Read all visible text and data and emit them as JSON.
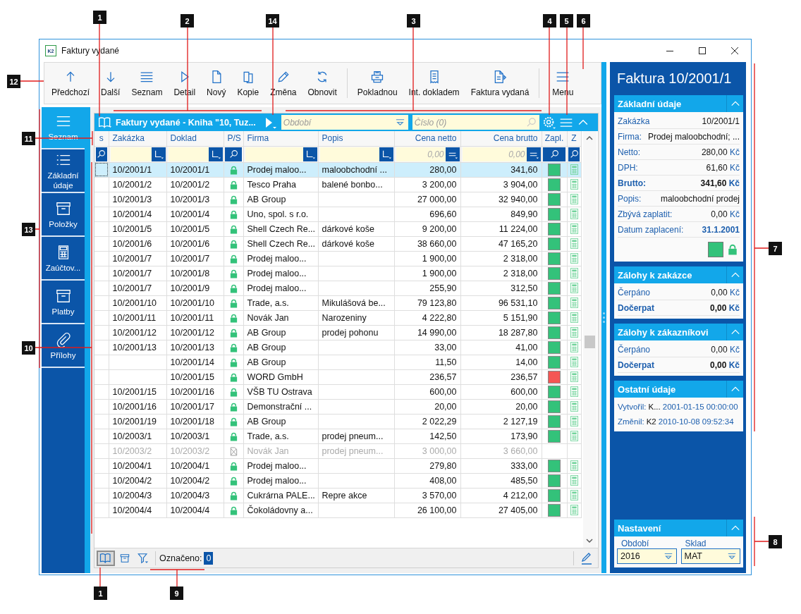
{
  "window": {
    "title": "Faktury vydané",
    "app_icon_label": "K2"
  },
  "toolbar": {
    "groups": [
      [
        {
          "label": "Předchozí",
          "kind": "up"
        },
        {
          "label": "Další",
          "kind": "down"
        },
        {
          "label": "Seznam",
          "kind": "list"
        },
        {
          "label": "Detail",
          "kind": "play"
        },
        {
          "label": "Nový",
          "kind": "page"
        },
        {
          "label": "Kopie",
          "kind": "copy"
        },
        {
          "label": "Změna",
          "kind": "pencil"
        },
        {
          "label": "Obnovit",
          "kind": "refresh"
        }
      ],
      [
        {
          "label": "Pokladnou",
          "kind": "register"
        },
        {
          "label": "Int. dokladem",
          "kind": "receipt"
        },
        {
          "label": "Faktura vydaná",
          "kind": "docarrow"
        }
      ],
      [
        {
          "label": "Menu",
          "kind": "menu"
        }
      ]
    ]
  },
  "nav": [
    {
      "label": "Seznam",
      "kind": "menu",
      "selected": true
    },
    {
      "label": "Základní údaje",
      "kind": "bullets",
      "selected": false
    },
    {
      "label": "Položky",
      "kind": "box",
      "selected": false
    },
    {
      "label": "Zaúčtov...",
      "kind": "calc",
      "selected": false
    },
    {
      "label": "Platby",
      "kind": "box",
      "selected": false
    },
    {
      "label": "Přílohy",
      "kind": "clip",
      "selected": false
    }
  ],
  "grid": {
    "title": "Faktury vydané - Kniha \"10, Tuz...",
    "period_placeholder": "Období",
    "number_placeholder": "Číslo (0)",
    "columns": [
      "s",
      "Zakázka",
      "Doklad",
      "P/S",
      "Firma",
      "Popis",
      "Cena netto",
      "Cena brutto",
      "Zapl.",
      "Z"
    ],
    "filters": [
      {
        "kind": "search"
      },
      {
        "kind": "text"
      },
      {
        "kind": "text"
      },
      {
        "kind": "search"
      },
      {
        "kind": "text"
      },
      {
        "kind": "text"
      },
      {
        "kind": "number",
        "placeholder": "0,00"
      },
      {
        "kind": "number",
        "placeholder": "0,00"
      },
      {
        "kind": "search"
      },
      {
        "kind": "search"
      }
    ],
    "rows": [
      {
        "zakazka": "10/2001/1",
        "doklad": "10/2001/1",
        "cancelled": false,
        "firma": "Prodej maloo...",
        "popis": "maloobchodní ...",
        "netto": "280,00",
        "brutto": "341,60",
        "color": "#33c27a",
        "accounted": true,
        "selected": true,
        "disabled": false
      },
      {
        "zakazka": "10/2001/2",
        "doklad": "10/2001/2",
        "cancelled": false,
        "firma": "Tesco Praha",
        "popis": "balené bonbo...",
        "netto": "3 200,00",
        "brutto": "3 904,00",
        "color": "#33c27a",
        "accounted": true,
        "selected": false,
        "disabled": false
      },
      {
        "zakazka": "10/2001/3",
        "doklad": "10/2001/3",
        "cancelled": false,
        "firma": "AB Group",
        "netto": "27 000,00",
        "brutto": "32 940,00",
        "color": "#33c27a",
        "accounted": true,
        "selected": false,
        "disabled": false
      },
      {
        "zakazka": "10/2001/4",
        "doklad": "10/2001/4",
        "cancelled": false,
        "firma": "Uno, spol. s r.o.",
        "netto": "696,60",
        "brutto": "849,90",
        "color": "#33c27a",
        "accounted": true,
        "selected": false,
        "disabled": false
      },
      {
        "zakazka": "10/2001/5",
        "doklad": "10/2001/5",
        "cancelled": false,
        "firma": "Shell Czech Re...",
        "popis": "dárkové koše",
        "netto": "9 200,00",
        "brutto": "11 224,00",
        "color": "#33c27a",
        "accounted": true,
        "selected": false,
        "disabled": false
      },
      {
        "zakazka": "10/2001/6",
        "doklad": "10/2001/6",
        "cancelled": false,
        "firma": "Shell Czech Re...",
        "popis": "dárkové koše",
        "netto": "38 660,00",
        "brutto": "47 165,20",
        "color": "#33c27a",
        "accounted": true,
        "selected": false,
        "disabled": false
      },
      {
        "zakazka": "10/2001/7",
        "doklad": "10/2001/7",
        "cancelled": false,
        "firma": "Prodej maloo...",
        "netto": "1 900,00",
        "brutto": "2 318,00",
        "color": "#33c27a",
        "accounted": true,
        "selected": false,
        "disabled": false
      },
      {
        "zakazka": "10/2001/7",
        "doklad": "10/2001/8",
        "cancelled": false,
        "firma": "Prodej maloo...",
        "netto": "1 900,00",
        "brutto": "2 318,00",
        "color": "#33c27a",
        "accounted": true,
        "selected": false,
        "disabled": false
      },
      {
        "zakazka": "10/2001/7",
        "doklad": "10/2001/9",
        "cancelled": false,
        "firma": "Prodej maloo...",
        "netto": "255,90",
        "brutto": "312,50",
        "color": "#33c27a",
        "accounted": true,
        "selected": false,
        "disabled": false
      },
      {
        "zakazka": "10/2001/10",
        "doklad": "10/2001/10",
        "cancelled": false,
        "firma": "Trade, a.s.",
        "popis": "Mikulášová be...",
        "netto": "79 123,80",
        "brutto": "96 531,10",
        "color": "#33c27a",
        "accounted": true,
        "selected": false,
        "disabled": false
      },
      {
        "zakazka": "10/2001/11",
        "doklad": "10/2001/11",
        "cancelled": false,
        "firma": "Novák Jan",
        "popis": "Narozeniny",
        "netto": "4 222,80",
        "brutto": "5 151,90",
        "color": "#33c27a",
        "accounted": true,
        "selected": false,
        "disabled": false
      },
      {
        "zakazka": "10/2001/12",
        "doklad": "10/2001/12",
        "cancelled": false,
        "firma": "AB Group",
        "popis": "prodej pohonu",
        "netto": "14 990,00",
        "brutto": "18 287,80",
        "color": "#33c27a",
        "accounted": true,
        "selected": false,
        "disabled": false
      },
      {
        "zakazka": "10/2001/13",
        "doklad": "10/2001/13",
        "cancelled": false,
        "firma": "AB Group",
        "netto": "33,00",
        "brutto": "41,00",
        "color": "#33c27a",
        "accounted": true,
        "selected": false,
        "disabled": false
      },
      {
        "doklad": "10/2001/14",
        "cancelled": false,
        "firma": "AB Group",
        "netto": "11,50",
        "brutto": "14,00",
        "color": "#33c27a",
        "accounted": true,
        "selected": false,
        "disabled": false
      },
      {
        "doklad": "10/2001/15",
        "cancelled": false,
        "firma": "WORD GmbH",
        "netto": "236,57",
        "brutto": "236,57",
        "color": "#f45654",
        "accounted": true,
        "selected": false,
        "disabled": false
      },
      {
        "zakazka": "10/2001/15",
        "doklad": "10/2001/16",
        "cancelled": false,
        "firma": "VŠB TU Ostrava",
        "netto": "600,00",
        "brutto": "600,00",
        "color": "#33c27a",
        "accounted": true,
        "selected": false,
        "disabled": false
      },
      {
        "zakazka": "10/2001/16",
        "doklad": "10/2001/17",
        "cancelled": false,
        "firma": "Demonstrační ...",
        "netto": "20,00",
        "brutto": "20,00",
        "color": "#33c27a",
        "accounted": true,
        "selected": false,
        "disabled": false
      },
      {
        "zakazka": "10/2001/19",
        "doklad": "10/2001/18",
        "cancelled": false,
        "firma": "AB Group",
        "netto": "2 022,29",
        "brutto": "2 127,19",
        "color": "#33c27a",
        "accounted": true,
        "selected": false,
        "disabled": false
      },
      {
        "zakazka": "10/2003/1",
        "doklad": "10/2003/1",
        "cancelled": false,
        "firma": "Trade, a.s.",
        "popis": "prodej pneum...",
        "netto": "142,50",
        "brutto": "173,90",
        "color": "#33c27a",
        "accounted": true,
        "selected": false,
        "disabled": false
      },
      {
        "zakazka": "10/2003/2",
        "doklad": "10/2003/2",
        "cancelled": true,
        "firma": "Novák Jan",
        "popis": "prodej pneum...",
        "netto": "3 000,00",
        "brutto": "3 660,00",
        "accounted": false,
        "selected": false,
        "disabled": true
      },
      {
        "zakazka": "10/2004/1",
        "doklad": "10/2004/1",
        "cancelled": false,
        "firma": "Prodej maloo...",
        "netto": "279,80",
        "brutto": "333,00",
        "color": "#33c27a",
        "accounted": true,
        "selected": false,
        "disabled": false
      },
      {
        "zakazka": "10/2004/2",
        "doklad": "10/2004/2",
        "cancelled": false,
        "firma": "Prodej maloo...",
        "netto": "408,00",
        "brutto": "485,50",
        "color": "#33c27a",
        "accounted": true,
        "selected": false,
        "disabled": false
      },
      {
        "zakazka": "10/2004/3",
        "doklad": "10/2004/3",
        "cancelled": false,
        "firma": "Cukrárna PALE...",
        "popis": "Repre akce",
        "netto": "3 570,00",
        "brutto": "4 212,00",
        "color": "#33c27a",
        "accounted": true,
        "selected": false,
        "disabled": false
      },
      {
        "zakazka": "10/2004/4",
        "doklad": "10/2004/4",
        "cancelled": false,
        "firma": "Čokoládovny a...",
        "netto": "26 100,00",
        "brutto": "27 405,00",
        "color": "#33c27a",
        "accounted": true,
        "selected": false,
        "disabled": false
      }
    ]
  },
  "footer": {
    "marked_label": "Označeno:",
    "marked_count": "0"
  },
  "detail": {
    "title": "Faktura 10/2001/1",
    "sections": [
      {
        "title": "Základní údaje",
        "rows": [
          {
            "kind": "plain",
            "label": "Zakázka",
            "value": "10/2001/1"
          },
          {
            "kind": "plain",
            "label": "Firma:",
            "value": "Prodej maloobchodní; ..."
          },
          {
            "kind": "plain",
            "label": "Netto:",
            "value": "280,00",
            "unit": "Kč"
          },
          {
            "kind": "plain",
            "label": "DPH:",
            "value": "61,60",
            "unit": "Kč"
          },
          {
            "kind": "total",
            "label": "Brutto:",
            "value": "341,60",
            "unit": "Kč"
          },
          {
            "kind": "plain",
            "label": "Popis:",
            "value": "maloobchodní prodej"
          },
          {
            "kind": "plain",
            "label": "Zbývá zaplatit:",
            "value": "0,00",
            "unit": "Kč"
          },
          {
            "kind": "date",
            "label": "Datum zaplacení:",
            "value": "31.1.2001"
          }
        ],
        "color": "#33c27a",
        "locked": true
      },
      {
        "title": "Zálohy k zakázce",
        "rows": [
          {
            "kind": "plain",
            "label": "Čerpáno",
            "value": "0,00",
            "unit": "Kč"
          },
          {
            "kind": "total",
            "label": "Dočerpat",
            "value": "0,00",
            "unit": "Kč"
          }
        ]
      },
      {
        "title": "Zálohy k zákazníkovi",
        "rows": [
          {
            "kind": "plain",
            "label": "Čerpáno",
            "value": "0,00",
            "unit": "Kč"
          },
          {
            "kind": "total",
            "label": "Dočerpat",
            "value": "0,00",
            "unit": "Kč"
          }
        ]
      },
      {
        "title": "Ostatní údaje",
        "rows": [
          {
            "kind": "audit",
            "label": "Vytvořil:",
            "user": "K...",
            "value": "2001-01-15 00:00:00"
          },
          {
            "kind": "audit",
            "label": "Změnil:",
            "user": "K2",
            "value": "2010-10-08 09:52:34"
          }
        ]
      }
    ]
  },
  "settings": {
    "title": "Nastavení",
    "fields": [
      {
        "label": "Období",
        "value": "2016"
      },
      {
        "label": "Sklad",
        "value": "MAT"
      }
    ]
  },
  "callouts": [
    "1",
    "2",
    "14",
    "3",
    "4",
    "5",
    "6",
    "12",
    "11",
    "13",
    "10",
    "7",
    "8",
    "1",
    "9"
  ]
}
